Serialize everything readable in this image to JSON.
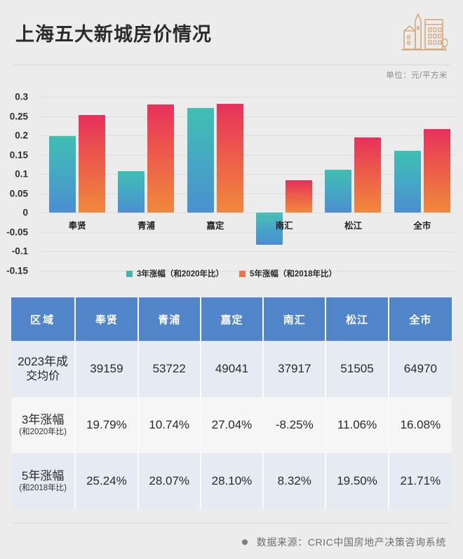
{
  "header": {
    "title": "上海五大新城房价情况",
    "unit_label": "单位：元/平方米",
    "icon": "city-buildings-icon",
    "icon_color": "#d8a87a"
  },
  "chart_data": {
    "type": "bar",
    "title": "",
    "subtitle": "",
    "xlabel": "",
    "ylabel": "",
    "categories": [
      "奉贤",
      "青浦",
      "嘉定",
      "南汇",
      "松江",
      "全市"
    ],
    "series": [
      {
        "name": "3年涨幅（和2020年比）",
        "color_start": "#3fbfb2",
        "color_end": "#4a8fd0",
        "values": [
          0.1979,
          0.1074,
          0.2704,
          -0.0825,
          0.1106,
          0.1608
        ]
      },
      {
        "name": "5年涨幅（和2018年比）",
        "color_start": "#e8305c",
        "color_end": "#f0893c",
        "values": [
          0.2524,
          0.2807,
          0.281,
          0.0832,
          0.195,
          0.2171
        ]
      }
    ],
    "ylim": [
      -0.15,
      0.3
    ],
    "yticks": [
      "0.3",
      "0.25",
      "0.2",
      "0.15",
      "0.1",
      "0.05",
      "0",
      "-0.05",
      "-0.1",
      "-0.15"
    ],
    "ytick_values": [
      0.3,
      0.25,
      0.2,
      0.15,
      0.1,
      0.05,
      0,
      -0.05,
      -0.1,
      -0.15
    ],
    "grid": true,
    "legend_position": "bottom"
  },
  "table": {
    "headers": [
      "区域",
      "奉贤",
      "青浦",
      "嘉定",
      "南汇",
      "松江",
      "全市"
    ],
    "rows": [
      {
        "label": "2023年成",
        "label2": "交均价",
        "sub": "",
        "cells": [
          "39159",
          "53722",
          "49041",
          "37917",
          "51505",
          "64970"
        ],
        "highlight_index": -1
      },
      {
        "label": "3年涨幅",
        "label2": "",
        "sub": "(和2020年比)",
        "cells": [
          "19.79%",
          "10.74%",
          "27.04%",
          "-8.25%",
          "11.06%",
          "16.08%"
        ],
        "highlight_index": 2
      },
      {
        "label": "5年涨幅",
        "label2": "",
        "sub": "(和2018年比)",
        "cells": [
          "25.24%",
          "28.07%",
          "28.10%",
          "8.32%",
          "19.50%",
          "21.71%"
        ],
        "highlight_index": 2
      }
    ],
    "header_bg": "#5184c8",
    "highlight_color": "#ef3b38"
  },
  "footer": {
    "bullet": "●",
    "text": "数据来源：CRIC中国房地产决策咨询系统"
  }
}
